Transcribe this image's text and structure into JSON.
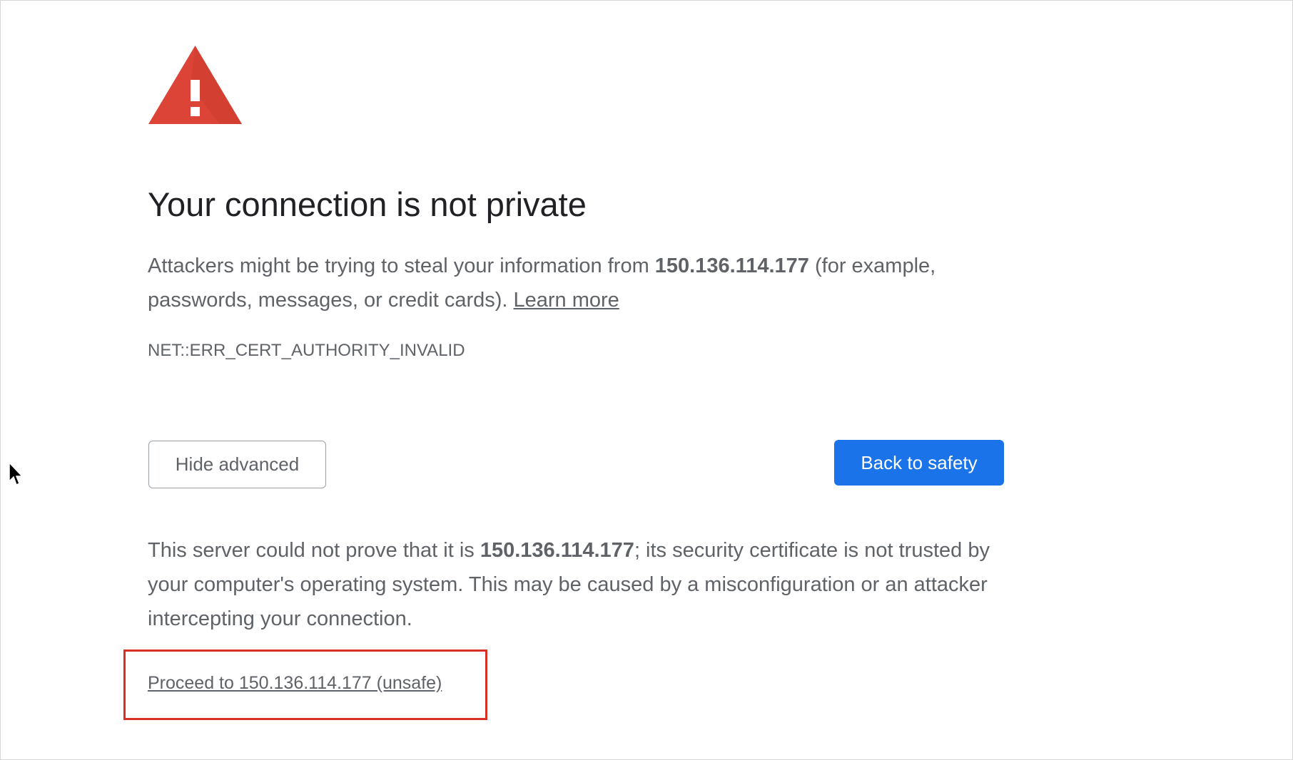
{
  "page": {
    "title": "Your connection is not private",
    "explanation": {
      "prefix": "Attackers might be trying to steal your information from ",
      "host": "150.136.114.177",
      "suffix": " (for example, passwords, messages, or credit cards). ",
      "learn_more": "Learn more"
    },
    "error_code": "NET::ERR_CERT_AUTHORITY_INVALID",
    "buttons": {
      "hide_advanced": "Hide advanced",
      "back_to_safety": "Back to safety"
    },
    "details": {
      "prefix": "This server could not prove that it is ",
      "host": "150.136.114.177",
      "suffix": "; its security certificate is not trusted by your computer's operating system. This may be caused by a misconfiguration or an attacker intercepting your connection."
    },
    "proceed_link": "Proceed to 150.136.114.177 (unsafe)"
  },
  "colors": {
    "warning_red": "#db4437",
    "primary_blue": "#1a73e8",
    "heading": "#202124",
    "body_text": "#5f6368",
    "highlight_border": "#d93025"
  },
  "icons": {
    "warning": "warning-triangle-icon",
    "cursor": "mouse-pointer-icon"
  }
}
